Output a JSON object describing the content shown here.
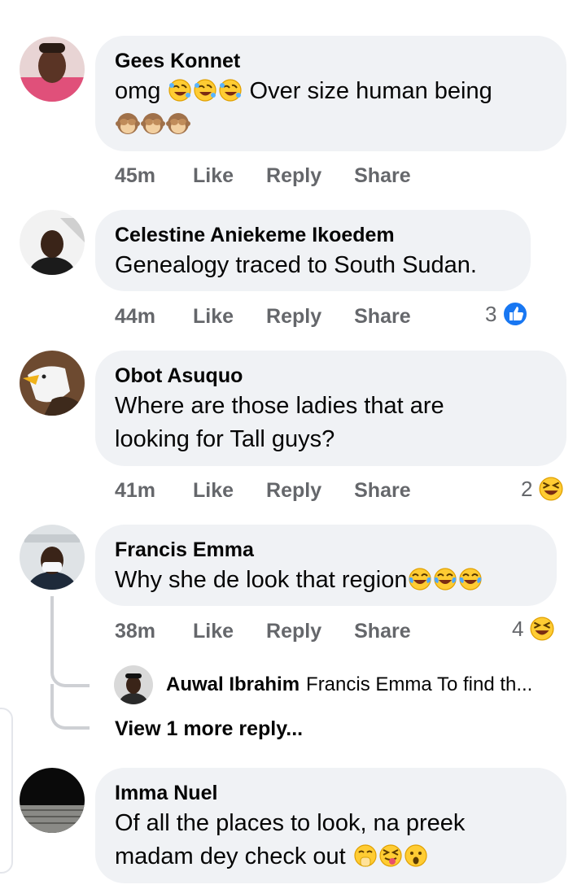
{
  "comments": [
    {
      "author": "Gees Konnet",
      "text_line1": "omg",
      "text_line1_after": "Over size human being",
      "time": "45m",
      "like": "Like",
      "reply": "Reply",
      "share": "Share"
    },
    {
      "author": "Celestine Aniekeme Ikoedem",
      "text": "Genealogy traced to South Sudan.",
      "time": "44m",
      "like": "Like",
      "reply": "Reply",
      "share": "Share",
      "reaction_count": "3",
      "reaction_icon": "like-thumb-icon"
    },
    {
      "author": "Obot Asuquo",
      "text_line1": "Where are those ladies that are",
      "text_line2": "looking for Tall guys?",
      "time": "41m",
      "like": "Like",
      "reply": "Reply",
      "share": "Share",
      "reaction_count": "2",
      "reaction_icon": "haha-icon"
    },
    {
      "author": "Francis Emma",
      "text": "Why she de look that region",
      "time": "38m",
      "like": "Like",
      "reply": "Reply",
      "share": "Share",
      "reaction_count": "4",
      "reaction_icon": "haha-icon",
      "reply_preview": {
        "author": "Auwal Ibrahim",
        "text": "Francis Emma To find th..."
      },
      "more_replies": "View 1 more reply..."
    },
    {
      "author": "Imma Nuel",
      "text_line1": "Of all the places to look, na preek",
      "text_line2": "madam dey check out"
    }
  ],
  "colors": {
    "bubble": "#f0f2f5",
    "meta": "#65676b",
    "like_blue": "#1877f2",
    "thread": "#ced0d4"
  }
}
